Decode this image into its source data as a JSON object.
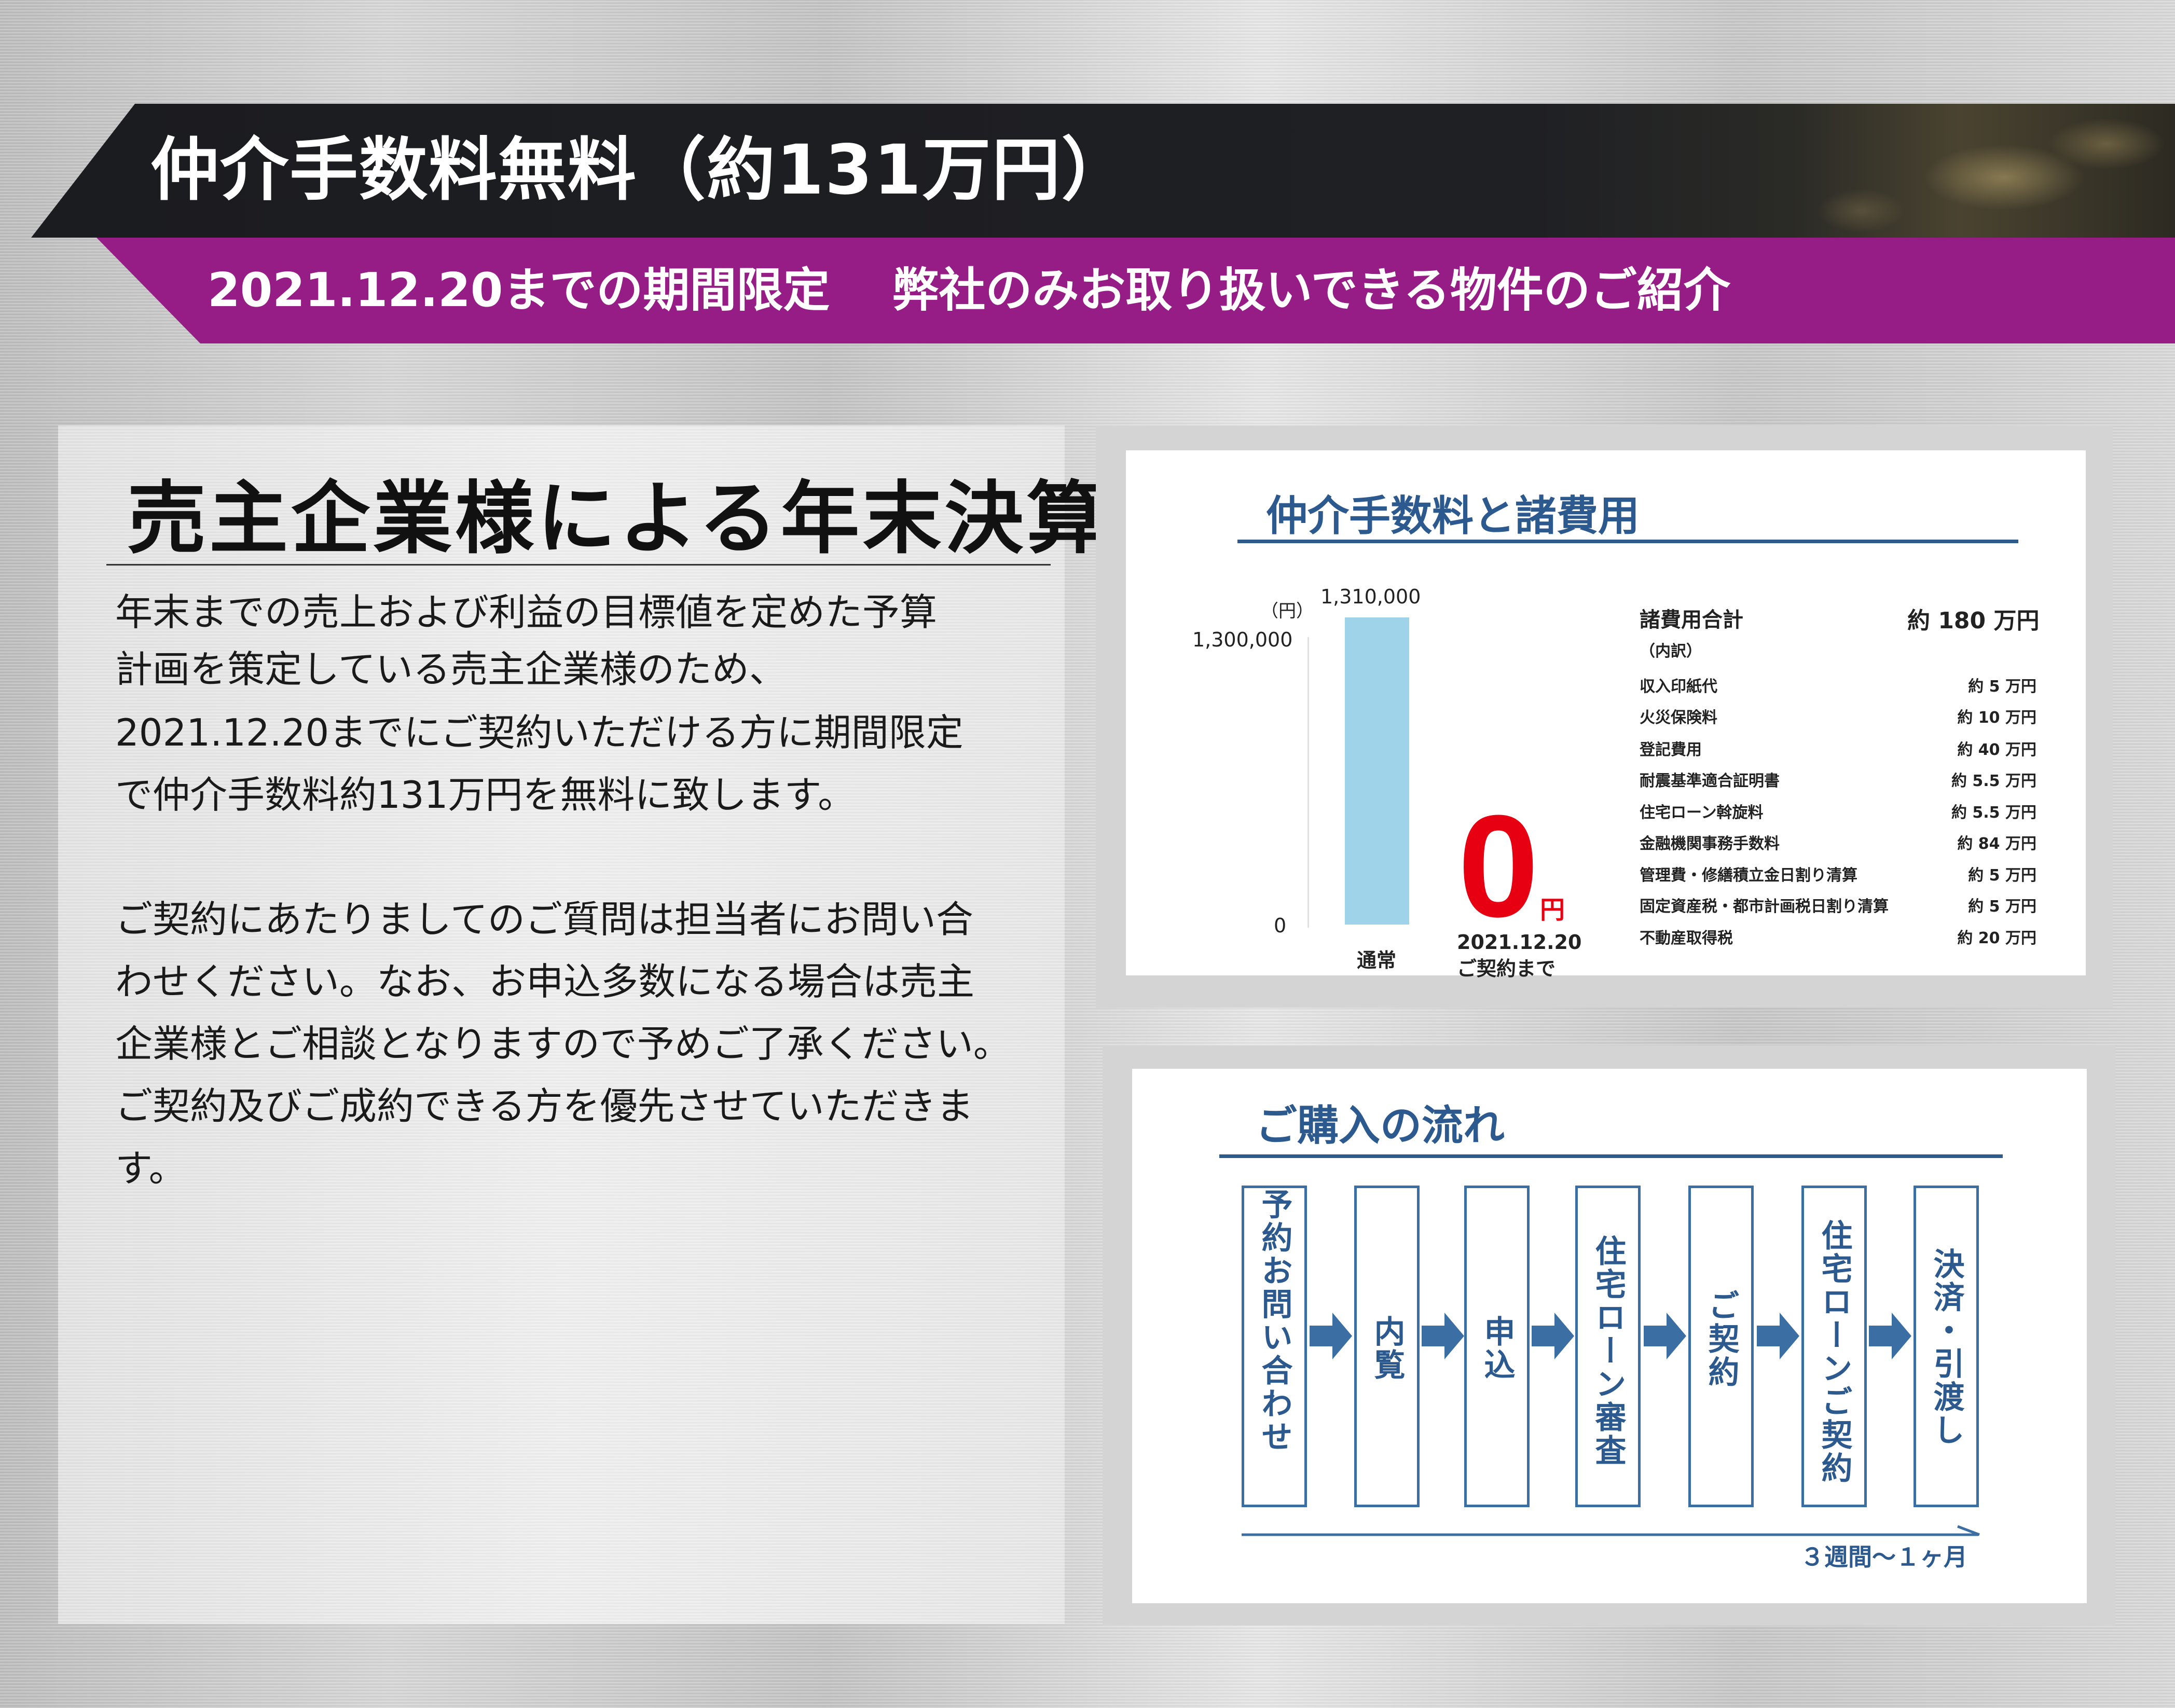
{
  "header": {
    "title": "仲介手数料無料（約131万円）",
    "subtitle_period": "2021.12.20までの期間限定",
    "subtitle_offer": "弊社のみお取り扱いできる物件のご紹介"
  },
  "left": {
    "heading": "売主企業様による年末決算",
    "paragraph1": [
      "年末までの売上および利益の目標値を定めた予算",
      "計画を策定している売主企業様のため、",
      "2021.12.20までにご契約いただける方に期間限定",
      "で仲介手数料約131万円を無料に致します。"
    ],
    "paragraph2": [
      "ご契約にあたりましてのご質問は担当者にお問い合",
      "わせください。なお、お申込多数になる場合は売主",
      "企業様とご相談となりますので予めご了承ください。",
      "ご契約及びご成約できる方を優先させていただきま",
      "す。"
    ]
  },
  "fees": {
    "heading": "仲介手数料と諸費用",
    "chart": {
      "unit": "（円）",
      "y_top_label": "1,300,000",
      "y_zero_label": "0",
      "bar1_value_label": "1,310,000",
      "bar1_value": 1310000,
      "bar1_label": "通常",
      "bar2_value": 0,
      "bar2_big": "0",
      "bar2_unit": "円",
      "bar2_label_line1": "2021.12.20",
      "bar2_label_line2": "ご契約まで",
      "bar_color": "#9fd3e9",
      "zero_color": "#e60012"
    },
    "total_label": "諸費用合計",
    "total_value": "約 180 万円",
    "breakdown_label": "（内訳）",
    "items": [
      {
        "name": "収入印紙代",
        "value": "約 5 万円"
      },
      {
        "name": "火災保険料",
        "value": "約 10 万円"
      },
      {
        "name": "登記費用",
        "value": "約 40 万円"
      },
      {
        "name": "耐震基準適合証明書",
        "value": "約 5.5 万円"
      },
      {
        "name": "住宅ローン斡旋料",
        "value": "約 5.5 万円"
      },
      {
        "name": "金融機関事務手数料",
        "value": "約 84 万円"
      },
      {
        "name": "管理費・修繕積立金日割り清算",
        "value": "約 5 万円"
      },
      {
        "name": "固定資産税・都市計画税日割り清算",
        "value": "約 5 万円"
      },
      {
        "name": "不動産取得税",
        "value": "約 20 万円"
      }
    ]
  },
  "flow": {
    "heading": "ご購入の流れ",
    "steps": [
      "予約お問い合わせ",
      "内覧",
      "申込",
      "住宅ローン審査",
      "ご契約",
      "住宅ローンご契約",
      "決済・引渡し"
    ],
    "duration": "３週間〜１ヶ月",
    "accent_color": "#2f5a8c"
  }
}
